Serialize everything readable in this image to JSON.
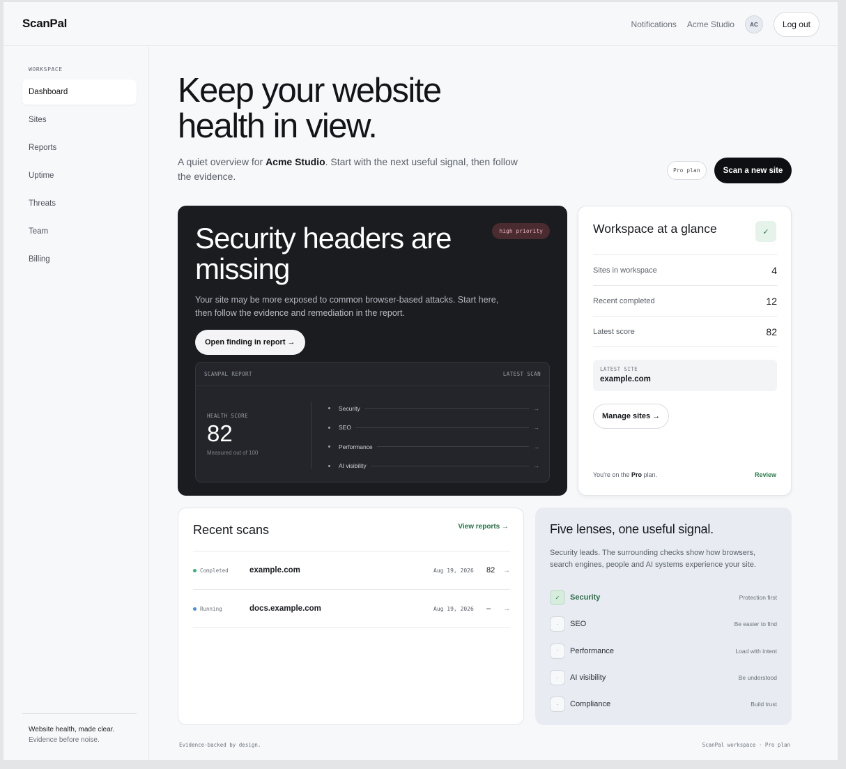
{
  "app": {
    "brand": "ScanPal"
  },
  "topnav": {
    "notifications": "Notifications",
    "workspace": "Acme Studio",
    "avatar_initials": "AC",
    "logout": "Log out"
  },
  "sidebar": {
    "heading": "WORKSPACE",
    "items": [
      {
        "label": "Dashboard",
        "active": true
      },
      {
        "label": "Sites"
      },
      {
        "label": "Reports"
      },
      {
        "label": "Uptime"
      },
      {
        "label": "Threats"
      },
      {
        "label": "Team"
      },
      {
        "label": "Billing"
      }
    ],
    "footer_line1": "Website health, made clear.",
    "footer_line2": "Evidence before noise."
  },
  "hero": {
    "title": "Keep your website health in view.",
    "sub_before": "A quiet overview for ",
    "sub_bold": "Acme Studio",
    "sub_after": ". Start with the next useful signal, then follow the evidence.",
    "plan_pill": "Pro plan",
    "cta": "Scan a new site"
  },
  "finding": {
    "title": "Security headers are missing",
    "badge": "high priority",
    "description": "Your site may be more exposed to common browser-based attacks. Start here, then follow the evidence and remediation in the report.",
    "button": "Open finding in report →",
    "report": {
      "header_left": "SCANPAL REPORT",
      "header_right": "LATEST SCAN",
      "score_label": "HEALTH SCORE",
      "score": "82",
      "score_note": "Measured out of 100",
      "lenses": [
        "Security",
        "SEO",
        "Performance",
        "AI visibility"
      ],
      "arrow": "→"
    }
  },
  "glance": {
    "title": "Workspace at a glance",
    "check_icon": "✓",
    "rows": [
      {
        "label": "Sites in workspace",
        "value": "4"
      },
      {
        "label": "Recent completed",
        "value": "12"
      },
      {
        "label": "Latest score",
        "value": "82"
      }
    ],
    "latest_site_label": "LATEST SITE",
    "latest_site": "example.com",
    "manage_button": "Manage sites →",
    "footer_before": "You're on the ",
    "footer_plan": "Pro",
    "footer_after": " plan.",
    "review": "Review"
  },
  "recent": {
    "title": "Recent scans",
    "view_all": "View reports →",
    "rows": [
      {
        "status": "Completed",
        "status_color": "#3fae7a",
        "site": "example.com",
        "date": "Aug 19, 2026",
        "score": "82",
        "arrow": "→"
      },
      {
        "status": "Running",
        "status_color": "#4a8fd6",
        "site": "docs.example.com",
        "date": "Aug 19, 2026",
        "score": "–",
        "arrow": "→"
      }
    ]
  },
  "lenses": {
    "title": "Five lenses, one useful signal.",
    "description": "Security leads. The surrounding checks show how browsers, search engines, people and AI systems experience your site.",
    "items": [
      {
        "name": "Security",
        "tag": "Protection first",
        "icon": "✓",
        "active": true
      },
      {
        "name": "SEO",
        "tag": "Be easier to find",
        "icon": "·"
      },
      {
        "name": "Performance",
        "tag": "Load with intent",
        "icon": "·"
      },
      {
        "name": "AI visibility",
        "tag": "Be understood",
        "icon": "·"
      },
      {
        "name": "Compliance",
        "tag": "Build trust",
        "icon": "·"
      }
    ]
  },
  "footer": {
    "left": "Evidence-backed by design.",
    "right": "ScanPal workspace · Pro plan"
  }
}
